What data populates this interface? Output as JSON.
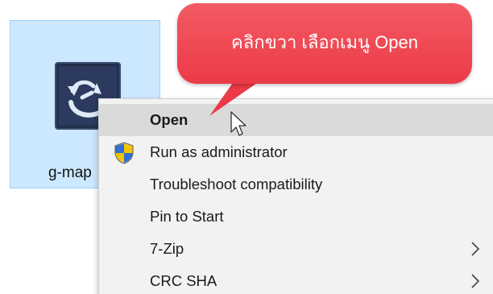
{
  "file": {
    "label": "g-map",
    "icon": "app-refresh-icon"
  },
  "context_menu": {
    "items": [
      {
        "label": "Open",
        "bold": true,
        "highlighted": true
      },
      {
        "label": "Run as administrator",
        "icon": "uac-shield-icon"
      },
      {
        "label": "Troubleshoot compatibility"
      },
      {
        "label": "Pin to Start"
      },
      {
        "label": "7-Zip",
        "submenu": true
      },
      {
        "label": "CRC SHA",
        "submenu": true
      }
    ]
  },
  "callout": {
    "text": "คลิกขวา เลือกเมนู Open",
    "color": "#ec3a47"
  },
  "colors": {
    "selection_bg": "#cce8ff",
    "menu_bg": "#f2f2f2",
    "menu_highlight": "#dadada"
  }
}
